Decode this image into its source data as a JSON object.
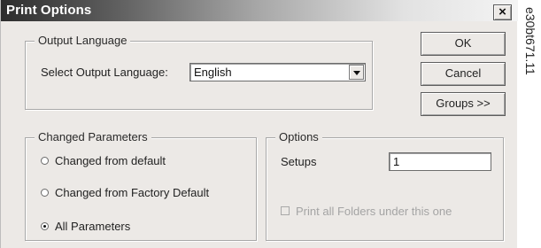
{
  "window": {
    "title": "Print Options",
    "close_glyph": "×"
  },
  "output_language": {
    "group_label": "Output Language",
    "select_label": "Select Output Language:",
    "selected_value": "English"
  },
  "buttons": {
    "ok": "OK",
    "cancel": "Cancel",
    "groups": "Groups >>"
  },
  "changed_parameters": {
    "group_label": "Changed Parameters",
    "options": [
      {
        "label": "Changed from default",
        "checked": false
      },
      {
        "label": "Changed from Factory Default",
        "checked": false
      },
      {
        "label": "All Parameters",
        "checked": true
      }
    ]
  },
  "options": {
    "group_label": "Options",
    "setups_label": "Setups",
    "setups_value": "1",
    "print_all_folders_label": "Print all Folders under this one",
    "print_all_folders_checked": false,
    "print_all_folders_enabled": false
  },
  "side_caption": "e30bt671.11",
  "colors": {
    "dialog_bg": "#ece9e6",
    "title_text": "#ffffff",
    "disabled_text": "#a4a4a4"
  }
}
